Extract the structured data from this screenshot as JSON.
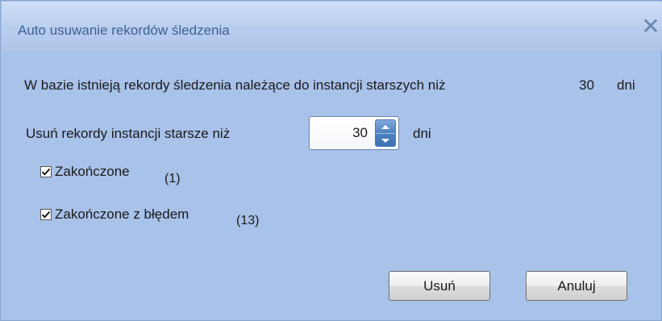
{
  "window": {
    "title": "Auto usuwanie rekordów śledzenia",
    "close_icon": "close-icon"
  },
  "info": {
    "text": "W bazie istnieją rekordy śledzenia należące do instancji starszych niż",
    "value": "30",
    "unit": "dni"
  },
  "delete_older": {
    "label": "Usuń rekordy instancji starsze niż",
    "value": "30",
    "unit": "dni"
  },
  "options": [
    {
      "label": "Zakończone",
      "count": "(1)",
      "checked": true
    },
    {
      "label": "Zakończone z błędem",
      "count": "(13)",
      "checked": true
    }
  ],
  "buttons": {
    "delete": "Usuń",
    "cancel": "Anuluj"
  },
  "colors": {
    "background": "#a8c2ea",
    "titlebar": "#b8cdee",
    "title_text": "#3f5f90",
    "spin_accent": "#4f82c4"
  }
}
